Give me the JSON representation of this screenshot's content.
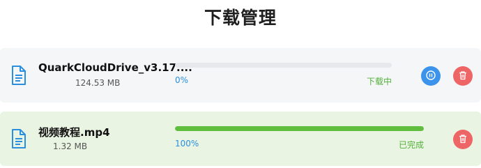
{
  "page": {
    "title": "下载管理"
  },
  "downloads": [
    {
      "name": "QuarkCloudDrive_v3.17....",
      "size": "124.53 MB",
      "progress": 0,
      "percent_label": "0%",
      "status": "下载中",
      "icon": "document-icon"
    },
    {
      "name": "视频教程.mp4",
      "size": "1.32 MB",
      "progress": 100,
      "percent_label": "100%",
      "status": "已完成",
      "icon": "document-icon"
    }
  ],
  "colors": {
    "accent_blue": "#3b93ec",
    "danger_red": "#ee6565",
    "success_green": "#5fbe3d",
    "progress_track": "#e6e8ee",
    "completed_card_bg": "#eaf4e2",
    "active_card_bg": "#f5f6f8"
  }
}
